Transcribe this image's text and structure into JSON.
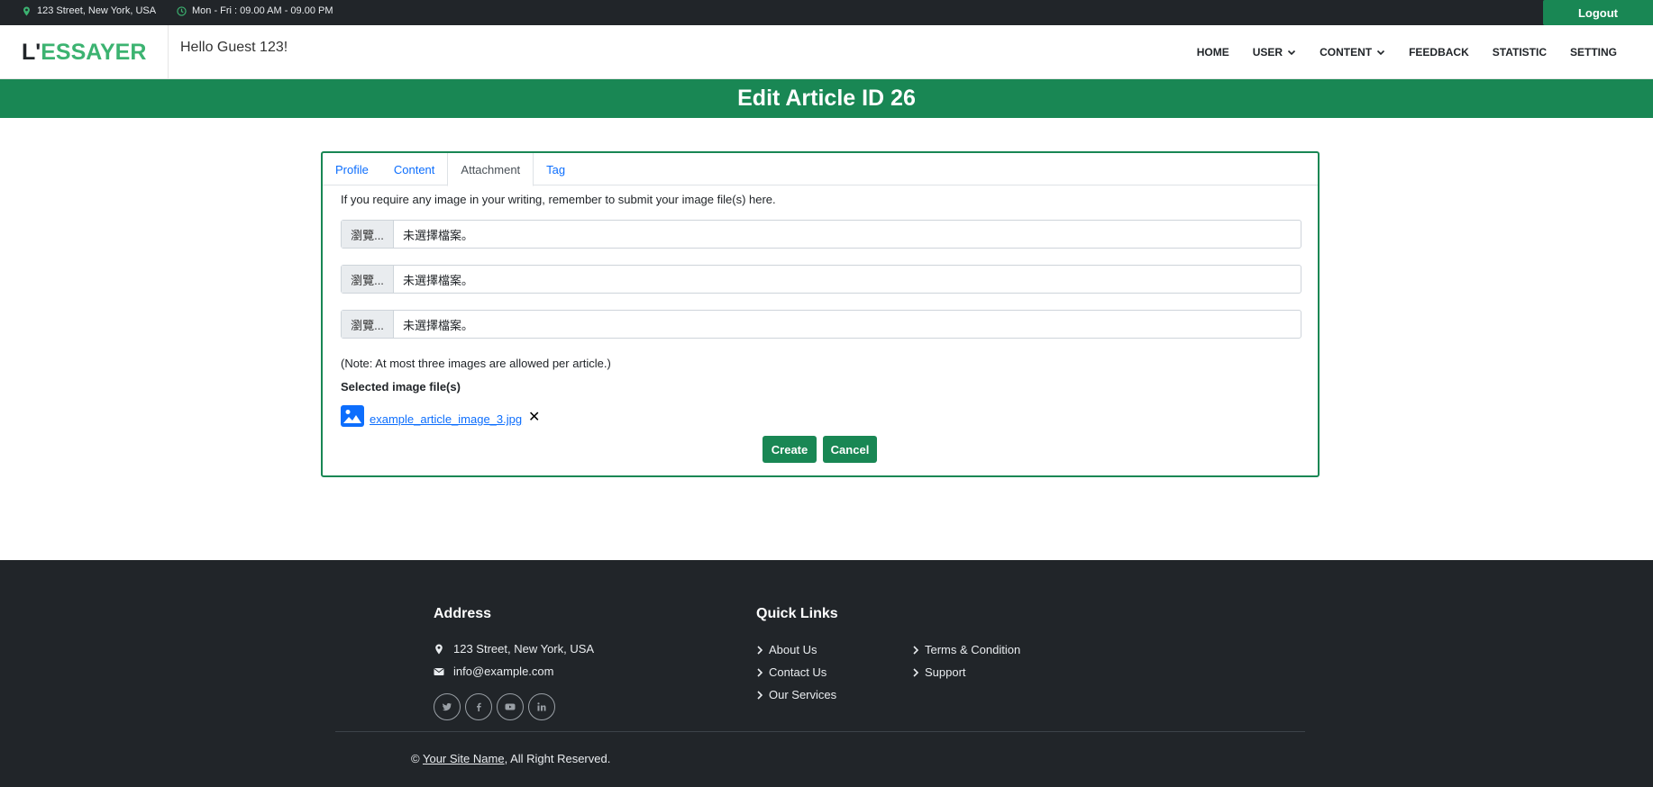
{
  "topbar": {
    "address": "123 Street, New York, USA",
    "hours": "Mon - Fri : 09.00 AM - 09.00 PM",
    "logout_label": "Logout"
  },
  "header": {
    "brand_prefix": "L'",
    "brand_rest": "ESSAYER",
    "greeting": "Hello Guest 123!",
    "nav": {
      "home": "HOME",
      "user": "USER",
      "content": "CONTENT",
      "feedback": "FEEDBACK",
      "statistic": "STATISTIC",
      "setting": "SETTING"
    }
  },
  "page_title": "Edit Article ID 26",
  "tabs": {
    "profile": "Profile",
    "content": "Content",
    "attachment": "Attachment",
    "tag": "Tag",
    "active": "Attachment"
  },
  "attachment": {
    "intro": "If you require any image in your writing, remember to submit your image file(s) here.",
    "file_inputs": [
      {
        "browse_label": "瀏覽...",
        "file_text": "未選擇檔案。"
      },
      {
        "browse_label": "瀏覽...",
        "file_text": "未選擇檔案。"
      },
      {
        "browse_label": "瀏覽...",
        "file_text": "未選擇檔案。"
      }
    ],
    "note": "(Note: At most three images are allowed per article.)",
    "selected_heading": "Selected image file(s)",
    "selected_file": "example_article_image_3.jpg",
    "remove_symbol": "✕",
    "create_label": "Create",
    "cancel_label": "Cancel"
  },
  "footer": {
    "address_heading": "Address",
    "address": "123 Street, New York, USA",
    "email": "info@example.com",
    "social_icons": [
      "twitter-icon",
      "facebook-icon",
      "youtube-icon",
      "linkedin-icon"
    ],
    "quick_links_heading": "Quick Links",
    "links": {
      "about": "About Us",
      "contact": "Contact Us",
      "services": "Our Services",
      "terms": "Terms & Condition",
      "support": "Support"
    },
    "copyright_symbol": "©",
    "site_name": "Your Site Name",
    "rights": ", All Right Reserved."
  },
  "colors": {
    "primary_green": "#198754",
    "dark": "#212529",
    "link_blue": "#0d6efd",
    "brand_green": "#3cb371"
  }
}
